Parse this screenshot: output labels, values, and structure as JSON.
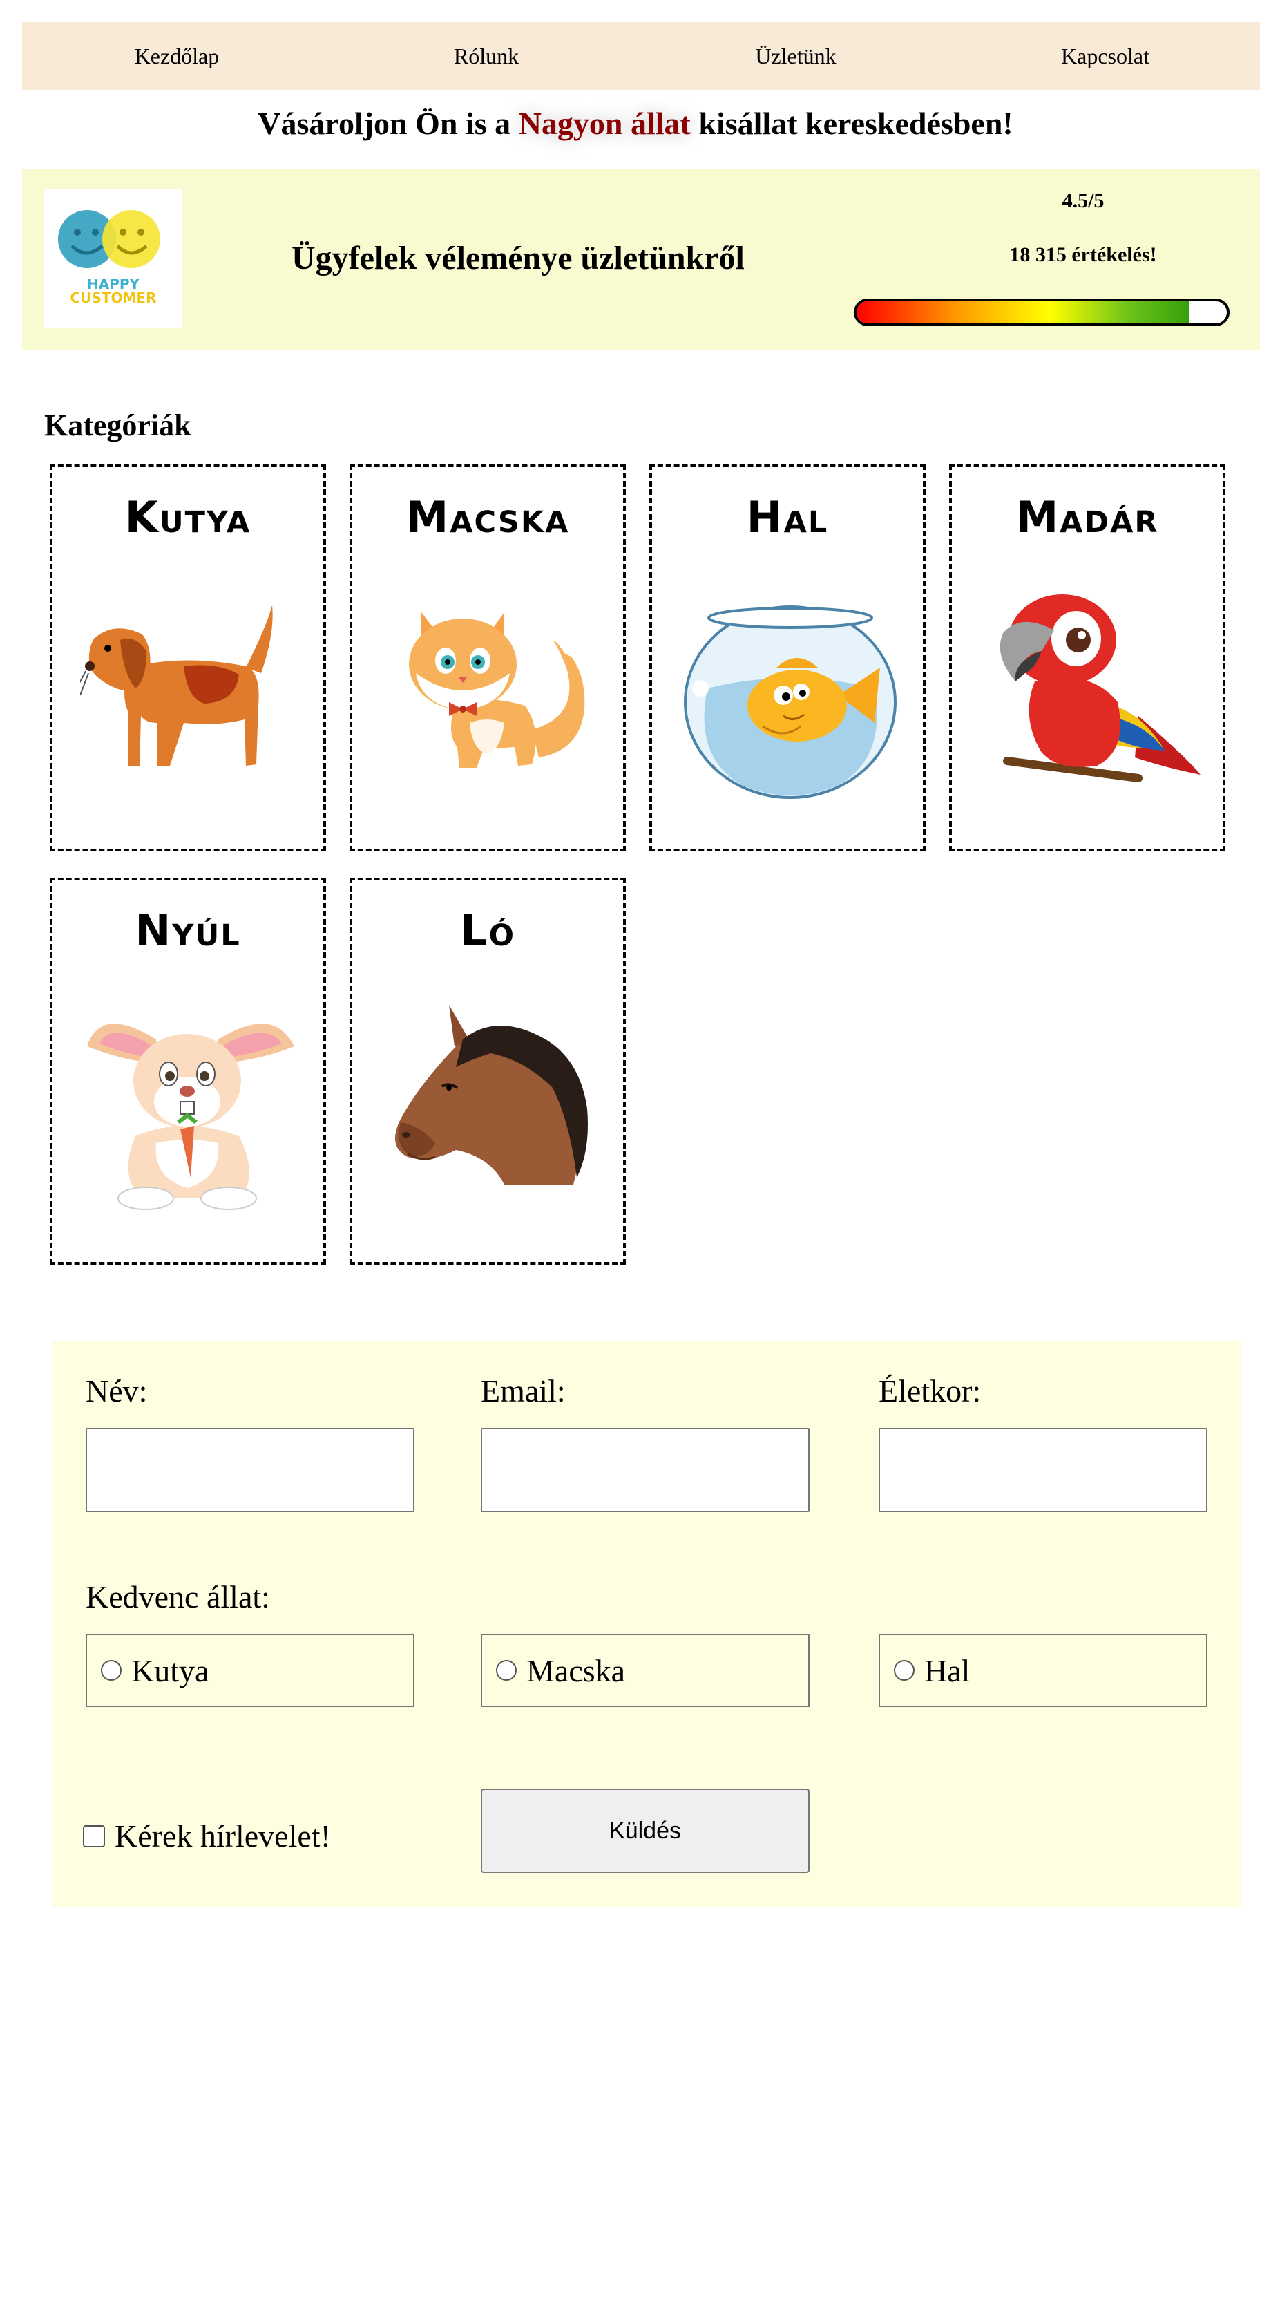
{
  "nav": {
    "items": [
      {
        "label": "Kezdőlap"
      },
      {
        "label": "Rólunk"
      },
      {
        "label": "Üzletünk"
      },
      {
        "label": "Kapcsolat"
      }
    ]
  },
  "headline": {
    "before": "Vásároljon Ön is a ",
    "highlight": "Nagyon állat",
    "after": " kisállat kereskedésben!",
    "highlight_color": "#8b0000"
  },
  "review": {
    "logo_line1": "HAPPY",
    "logo_line2": "CUSTOMER",
    "title": "Ügyfelek véleménye üzletünkről",
    "score": "4.5/5",
    "count": "18 315 értékelés!",
    "fill_fraction": 0.9
  },
  "categories": {
    "heading": "Kategóriák",
    "items": [
      {
        "title": "Kutya",
        "icon": "dog-icon"
      },
      {
        "title": "Macska",
        "icon": "cat-icon"
      },
      {
        "title": "Hal",
        "icon": "fishbowl-icon"
      },
      {
        "title": "Madár",
        "icon": "parrot-icon"
      },
      {
        "title": "Nyúl",
        "icon": "rabbit-icon"
      },
      {
        "title": "Ló",
        "icon": "horse-icon"
      }
    ]
  },
  "form": {
    "name_label": "Név:",
    "email_label": "Email:",
    "age_label": "Életkor:",
    "name_value": "",
    "email_value": "",
    "age_value": "",
    "favorite_label": "Kedvenc állat:",
    "options": [
      "Kutya",
      "Macska",
      "Hal"
    ],
    "newsletter_label": "Kérek hírlevelet!",
    "submit_label": "Küldés"
  },
  "colors": {
    "nav_bg": "#f9ead8",
    "review_bg": "#f8fad0",
    "form_bg": "#fefee0"
  }
}
